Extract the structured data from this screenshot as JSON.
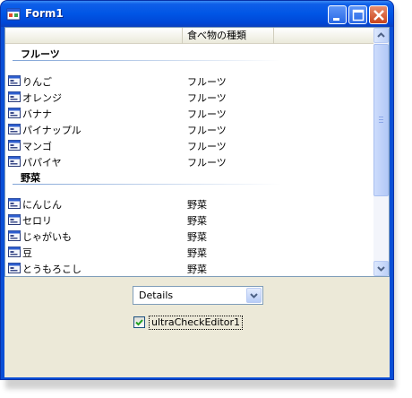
{
  "window": {
    "title": "Form1"
  },
  "listview": {
    "columns": [
      "",
      "食べ物の種類"
    ],
    "groups": [
      {
        "label": "フルーツ",
        "items": [
          {
            "name": "りんご",
            "type": "フルーツ"
          },
          {
            "name": "オレンジ",
            "type": "フルーツ"
          },
          {
            "name": "バナナ",
            "type": "フルーツ"
          },
          {
            "name": "パイナップル",
            "type": "フルーツ"
          },
          {
            "name": "マンゴ",
            "type": "フルーツ"
          },
          {
            "name": "パパイヤ",
            "type": "フルーツ"
          }
        ]
      },
      {
        "label": "野菜",
        "items": [
          {
            "name": "にんじん",
            "type": "野菜"
          },
          {
            "name": "セロリ",
            "type": "野菜"
          },
          {
            "name": "じゃがいも",
            "type": "野菜"
          },
          {
            "name": "豆",
            "type": "野菜"
          },
          {
            "name": "とうもろこし",
            "type": "野菜"
          }
        ]
      }
    ],
    "item_icon": "list-item-icon"
  },
  "view_combo": {
    "selected": "Details",
    "icon": "chevron-down-icon"
  },
  "check_editor": {
    "label": "ultraCheckEditor1",
    "checked": true
  },
  "colors": {
    "titlebar": "#0055e5",
    "client_bg": "#ece9d8",
    "close_button": "#c9441c",
    "group_line": "#7fa3d6"
  }
}
